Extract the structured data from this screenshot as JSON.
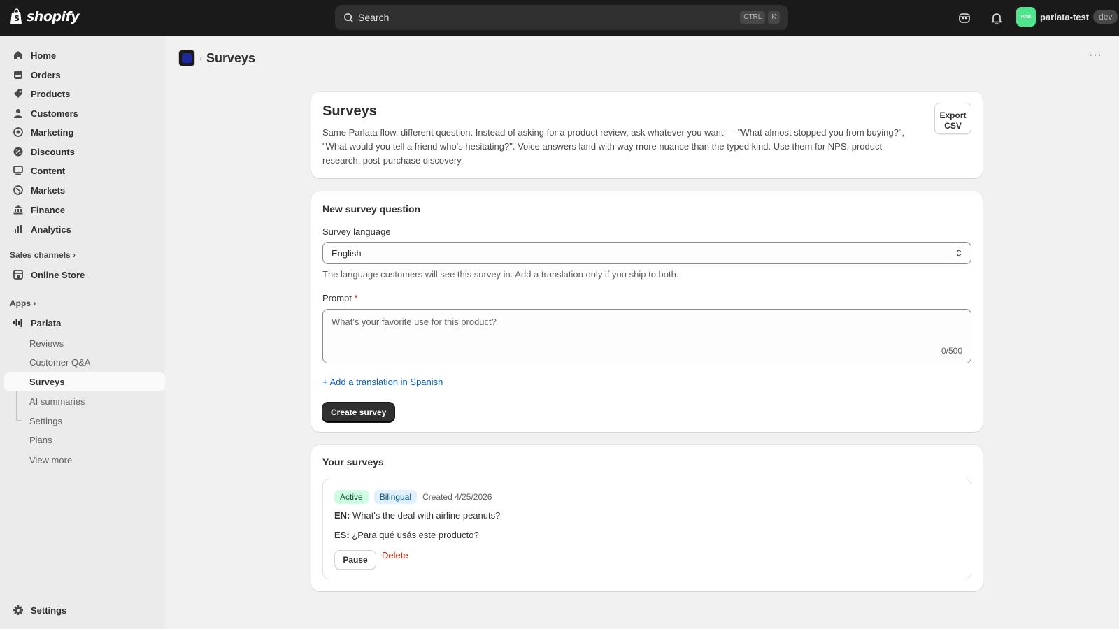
{
  "topbar": {
    "brand": "shopify",
    "search_placeholder": "Search",
    "shortcut_keys": [
      "CTRL",
      "K"
    ],
    "avatar_initials": "PAR",
    "store_name": "parlata-test",
    "store_badge": "dev"
  },
  "sidebar": {
    "items": [
      {
        "label": "Home",
        "icon": "home-icon"
      },
      {
        "label": "Orders",
        "icon": "orders-icon"
      },
      {
        "label": "Products",
        "icon": "tag-icon"
      },
      {
        "label": "Customers",
        "icon": "person-icon"
      },
      {
        "label": "Marketing",
        "icon": "target-icon"
      },
      {
        "label": "Discounts",
        "icon": "discount-icon"
      },
      {
        "label": "Content",
        "icon": "content-icon"
      },
      {
        "label": "Markets",
        "icon": "globe-icon"
      },
      {
        "label": "Finance",
        "icon": "bank-icon"
      },
      {
        "label": "Analytics",
        "icon": "chart-icon"
      }
    ],
    "sales_channels_heading": "Sales channels",
    "online_store": "Online Store",
    "apps_heading": "Apps",
    "app_name": "Parlata",
    "app_subitems": [
      "Reviews",
      "Customer Q&A",
      "Surveys",
      "AI summaries",
      "Settings",
      "Plans",
      "View more"
    ],
    "active_subitem": "Surveys",
    "settings": "Settings"
  },
  "page": {
    "breadcrumb_title": "Surveys",
    "intro": {
      "title": "Surveys",
      "description": "Same Parlata flow, different question. Instead of asking for a product review, ask whatever you want — \"What almost stopped you from buying?\", \"What would you tell a friend who's hesitating?\". Voice answers land with way more nuance than the typed kind. Use them for NPS, product research, post-purchase discovery.",
      "export_label_line1": "Export",
      "export_label_line2": "CSV"
    },
    "new_survey": {
      "heading": "New survey question",
      "language_label": "Survey language",
      "language_value": "English",
      "language_help": "The language customers will see this survey in. Add a translation only if you ship to both.",
      "prompt_label": "Prompt",
      "prompt_required_mark": "*",
      "prompt_placeholder": "What's your favorite use for this product?",
      "prompt_counter": "0/500",
      "add_translation_link": "+ Add a translation in Spanish",
      "create_button": "Create survey"
    },
    "your_surveys": {
      "heading": "Your surveys",
      "surveys": [
        {
          "status": "Active",
          "type": "Bilingual",
          "created": "Created 4/25/2026",
          "en_label": "EN:",
          "en_text": "What's the deal with airline peanuts?",
          "es_label": "ES:",
          "es_text": "¿Para qué usás este producto?",
          "pause_label": "Pause",
          "delete_label": "Delete"
        }
      ]
    }
  },
  "colors": {
    "topbar_bg": "#1a1a1a",
    "link_blue": "#005bd3",
    "danger": "#c5280c",
    "badge_active_bg": "#cdfee1",
    "badge_info_bg": "#e0f0ff",
    "avatar_bg": "#4ee48b"
  }
}
